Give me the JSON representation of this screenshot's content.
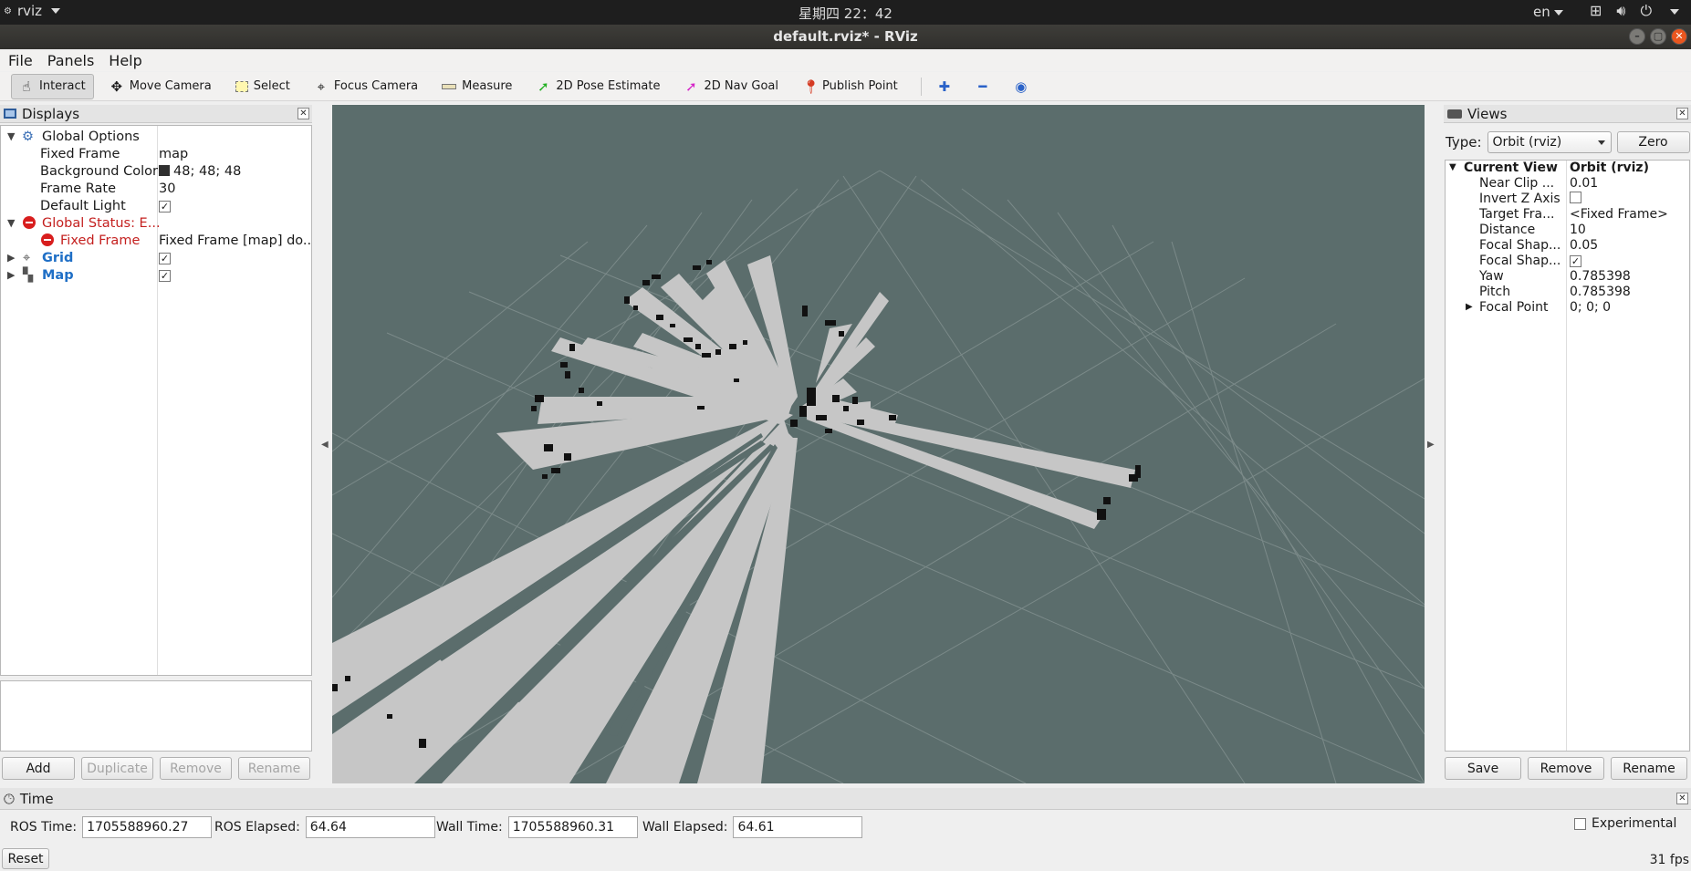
{
  "system_bar": {
    "app_name": "rviz",
    "clock": "星期四 22：42",
    "language": "en"
  },
  "window": {
    "title": "default.rviz* - RViz"
  },
  "menu": [
    "File",
    "Panels",
    "Help"
  ],
  "toolbar": {
    "tools": [
      {
        "label": "Interact",
        "icon": "hand-pointer-icon",
        "active": true
      },
      {
        "label": "Move Camera",
        "icon": "move-camera-icon"
      },
      {
        "label": "Select",
        "icon": "select-box-icon"
      },
      {
        "label": "Focus Camera",
        "icon": "focus-crosshair-icon"
      },
      {
        "label": "Measure",
        "icon": "ruler-icon"
      },
      {
        "label": "2D Pose Estimate",
        "icon": "green-arrow-icon"
      },
      {
        "label": "2D Nav Goal",
        "icon": "pink-arrow-icon"
      },
      {
        "label": "Publish Point",
        "icon": "map-pin-icon"
      }
    ]
  },
  "displays": {
    "title": "Displays",
    "items": {
      "global_options": "Global Options",
      "fixed_frame_key": "Fixed Frame",
      "fixed_frame_val": "map",
      "bg_color_key": "Background Color",
      "bg_color_val": "48; 48; 48",
      "frame_rate_key": "Frame Rate",
      "frame_rate_val": "30",
      "default_light_key": "Default Light",
      "global_status": "Global Status: E...",
      "status_fixed_frame_key": "Fixed Frame",
      "status_fixed_frame_val": "Fixed Frame [map] do...",
      "grid": "Grid",
      "map": "Map"
    },
    "buttons": {
      "add": "Add",
      "duplicate": "Duplicate",
      "remove": "Remove",
      "rename": "Rename"
    }
  },
  "views": {
    "title": "Views",
    "type_label": "Type:",
    "type_value": "Orbit (rviz)",
    "zero": "Zero",
    "current_view_key": "Current View",
    "current_view_val": "Orbit (rviz)",
    "props": [
      {
        "k": "Near Clip ...",
        "v": "0.01"
      },
      {
        "k": "Invert Z Axis",
        "v": ""
      },
      {
        "k": "Target Fra...",
        "v": "<Fixed Frame>"
      },
      {
        "k": "Distance",
        "v": "10"
      },
      {
        "k": "Focal Shap...",
        "v": "0.05"
      },
      {
        "k": "Focal Shap...",
        "v": ""
      },
      {
        "k": "Yaw",
        "v": "0.785398"
      },
      {
        "k": "Pitch",
        "v": "0.785398"
      },
      {
        "k": "Focal Point",
        "v": "0; 0; 0"
      }
    ],
    "buttons": {
      "save": "Save",
      "remove": "Remove",
      "rename": "Rename"
    }
  },
  "time": {
    "title": "Time",
    "ros_time_label": "ROS Time:",
    "ros_time": "1705588960.27",
    "ros_elapsed_label": "ROS Elapsed:",
    "ros_elapsed": "64.64",
    "wall_time_label": "Wall Time:",
    "wall_time": "1705588960.31",
    "wall_elapsed_label": "Wall Elapsed:",
    "wall_elapsed": "64.61",
    "experimental": "Experimental",
    "reset": "Reset",
    "fps": "31 fps"
  },
  "colors": {
    "viewport_bg": "#5b6d6c",
    "map_free": "#c6c6c6",
    "map_occupied": "#111111",
    "error": "#c4201f"
  }
}
